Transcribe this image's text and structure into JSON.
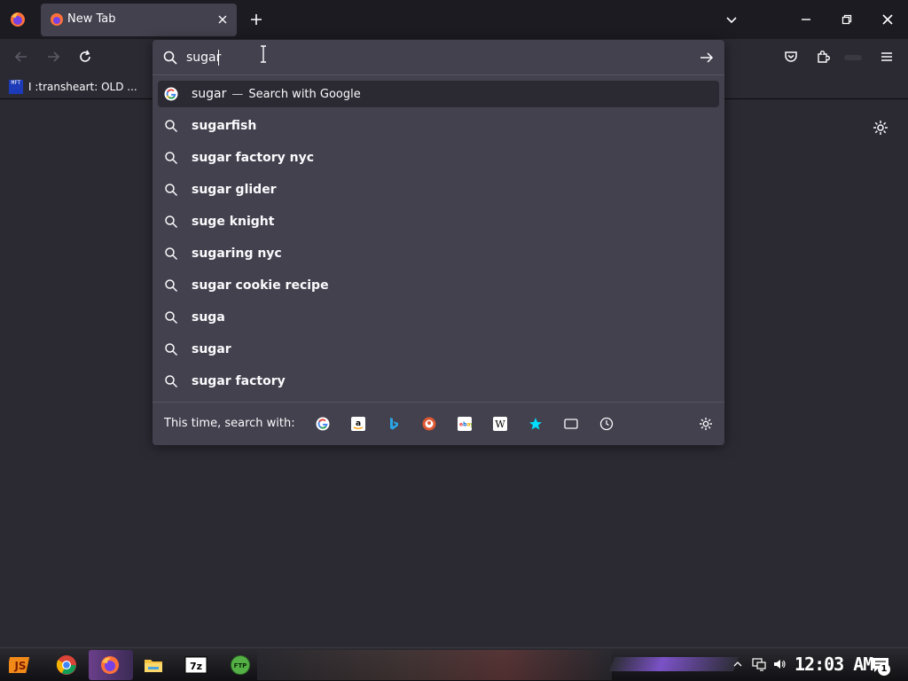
{
  "window": {
    "tab_title": "New Tab"
  },
  "bookmarks": {
    "items": [
      {
        "label": "I :transheart: OLD ...",
        "favicon_text": "MFT"
      }
    ]
  },
  "urlbar": {
    "value": "sugar",
    "selected_result": {
      "text": "sugar",
      "separator": "—",
      "action": "Search with Google"
    },
    "suggestions": [
      "sugarfish",
      "sugar factory nyc",
      "sugar glider",
      "suge knight",
      "sugaring nyc",
      "sugar cookie recipe",
      "suga",
      "sugar",
      "sugar factory"
    ],
    "oneoff_label": "This time, search with:",
    "oneoff_engines": [
      "google-icon",
      "amazon-icon",
      "bing-icon",
      "duckduckgo-icon",
      "ebay-icon",
      "wikipedia-icon",
      "bookmarks-icon",
      "tabs-icon",
      "history-icon"
    ]
  },
  "taskbar": {
    "clock": "12:03 AM",
    "notification_count": "1",
    "app_7z_label": "7z",
    "app_ftp_label": "FTP"
  },
  "colors": {
    "chrome_bg": "#1c1b22",
    "toolbar_bg": "#2b2a33",
    "popup_bg": "#42414d",
    "text": "#fbfbfe"
  }
}
